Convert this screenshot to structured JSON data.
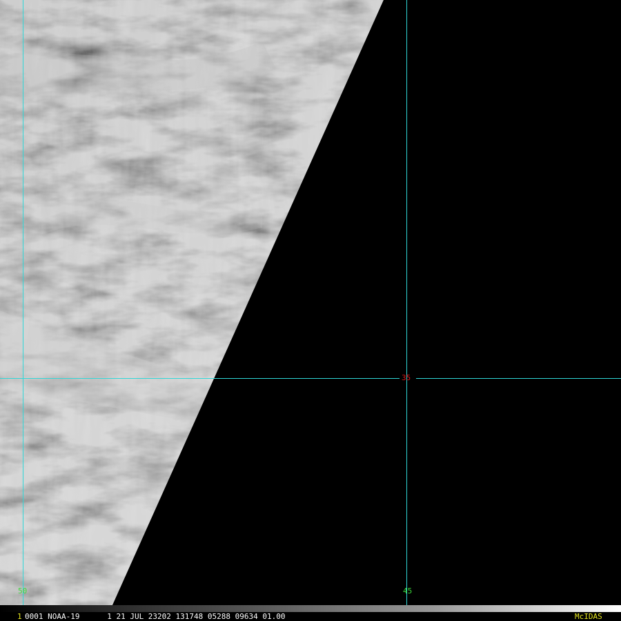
{
  "colors": {
    "grid_line": "#2fd8d8",
    "latitude_label": "#d81818",
    "longitude_label": "#3cd83c",
    "status_text": "#ffffff",
    "frame_number": "#e8e820",
    "brand": "#e8e820",
    "no_data": "#000000"
  },
  "grid": {
    "latitude_labels": [
      "35"
    ],
    "longitude_labels": [
      "50",
      "45"
    ]
  },
  "status_bar": {
    "frame_number": "1",
    "text": "0001 NOAA-19      1 21 JUL 23202 131748 05288 09634 01.00",
    "brand": "McIDAS"
  },
  "icons": {
    "imagery": "cloud-imagery-icon"
  }
}
